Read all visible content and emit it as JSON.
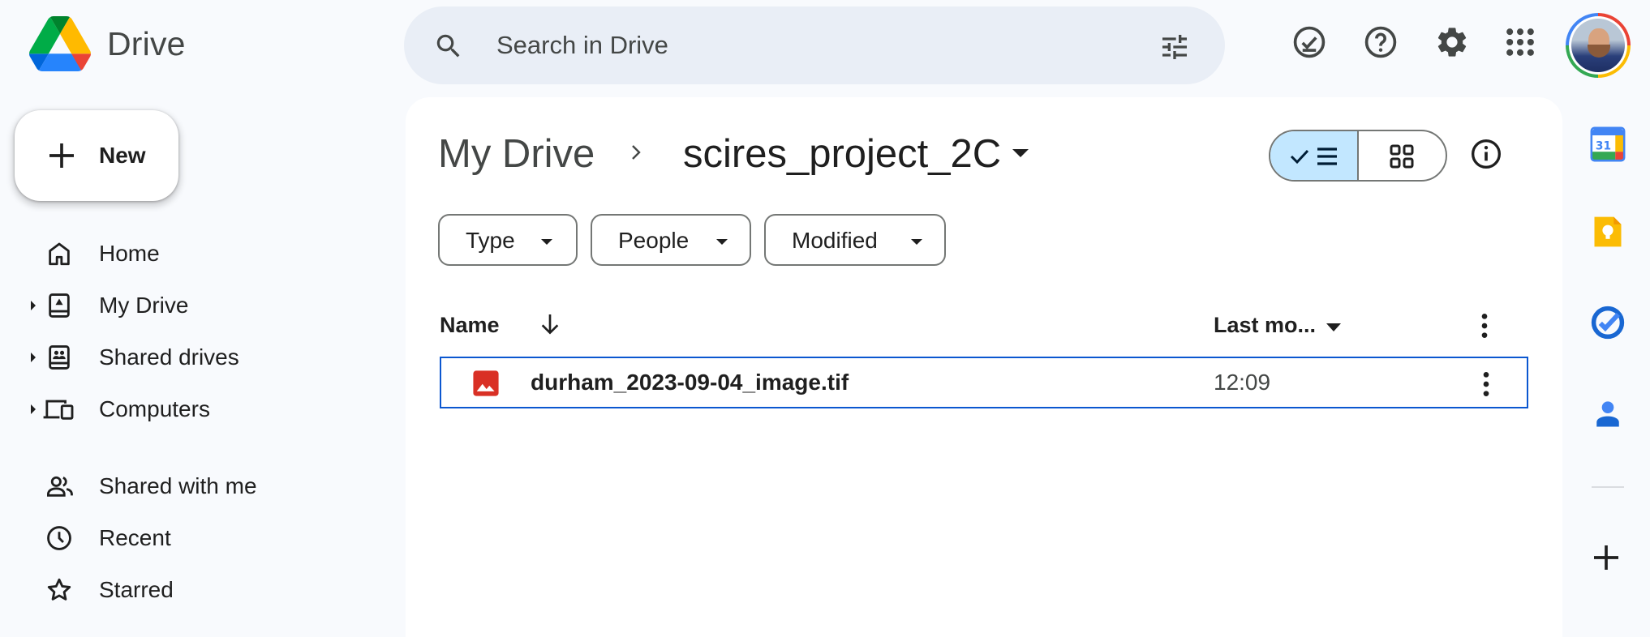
{
  "app": {
    "name": "Drive"
  },
  "search": {
    "placeholder": "Search in Drive"
  },
  "new_button": {
    "label": "New"
  },
  "nav": [
    {
      "label": "Home",
      "icon": "home-icon",
      "expandable": false
    },
    {
      "label": "My Drive",
      "icon": "my-drive-icon",
      "expandable": true
    },
    {
      "label": "Shared drives",
      "icon": "shared-drives-icon",
      "expandable": true
    },
    {
      "label": "Computers",
      "icon": "computers-icon",
      "expandable": true
    },
    {
      "label": "Shared with me",
      "icon": "shared-with-me-icon",
      "expandable": false
    },
    {
      "label": "Recent",
      "icon": "clock-icon",
      "expandable": false
    },
    {
      "label": "Starred",
      "icon": "star-icon",
      "expandable": false
    }
  ],
  "breadcrumb": {
    "root": "My Drive",
    "current": "scires_project_2C"
  },
  "filters": [
    {
      "label": "Type"
    },
    {
      "label": "People"
    },
    {
      "label": "Modified"
    }
  ],
  "table": {
    "columns": {
      "name": "Name",
      "modified": "Last mo..."
    },
    "rows": [
      {
        "name": "durham_2023-09-04_image.tif",
        "modified": "12:09",
        "type_icon": "image-file-icon",
        "selected": true
      }
    ]
  },
  "view": {
    "mode": "list"
  },
  "colors": {
    "accent": "#0b57d0",
    "search_bg": "#e9eef6",
    "page_bg": "#f8fafd",
    "toggle_selected": "#c2e7ff",
    "image_file": "#d93025"
  },
  "header_icons": [
    "ready-for-offline-icon",
    "help-icon",
    "settings-icon",
    "apps-grid-icon",
    "account-avatar"
  ],
  "side_apps": [
    "calendar-icon",
    "keep-icon",
    "tasks-icon",
    "contacts-icon",
    "add-app-icon"
  ],
  "calendar_badge": "31"
}
